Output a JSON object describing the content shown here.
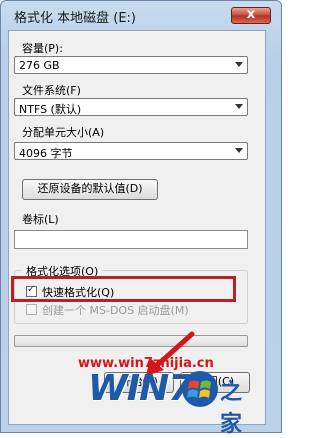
{
  "window": {
    "title": "格式化 本地磁盘 (E:)",
    "close_glyph": "x"
  },
  "capacity": {
    "label": "容量(P):",
    "value": "276 GB"
  },
  "filesystem": {
    "label": "文件系统(F)",
    "value": "NTFS (默认)"
  },
  "allocation": {
    "label": "分配单元大小(A)",
    "value": "4096 字节"
  },
  "restore_button": {
    "label": "还原设备的默认值(D)"
  },
  "volume": {
    "label": "卷标(L)",
    "value": ""
  },
  "options": {
    "label": "格式化选项(O)",
    "quick_format": {
      "label": "快速格式化(Q)",
      "checked": true
    },
    "msdos_disk": {
      "label": "创建一个 MS-DOS 启动盘(M)",
      "checked": false,
      "disabled": true
    }
  },
  "progress": {
    "fraction": 0
  },
  "start_button": {
    "label": "开始(S)"
  },
  "close_button": {
    "label": "关闭(C)"
  },
  "watermark": {
    "url": "www.win7zhijia.cn",
    "logo_text": "WIN7",
    "logo_suffix": "之家"
  },
  "colors": {
    "highlight": "#b42228",
    "watermark": "#d4161b",
    "logo_blue": "#1e5aa8"
  },
  "icons": {
    "windows_logo": "windows-flag-icon",
    "annotation_arrow": "red-arrow-icon"
  }
}
